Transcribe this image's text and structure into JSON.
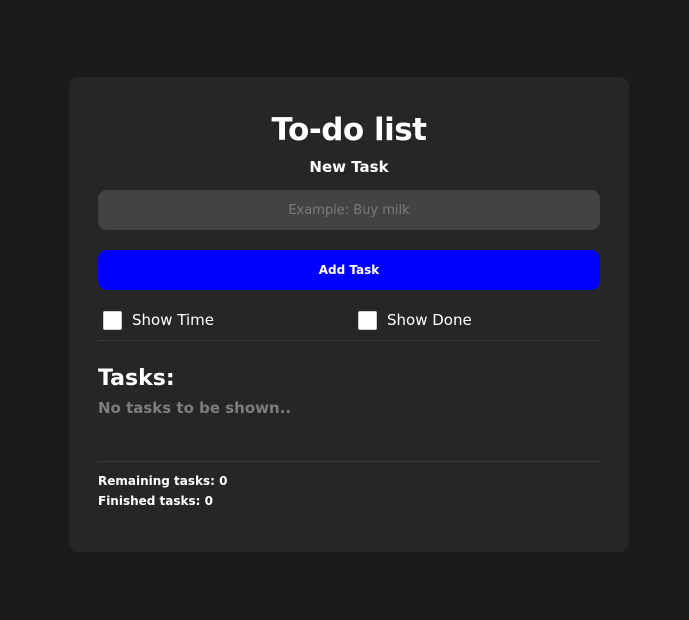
{
  "app": {
    "title": "To-do list",
    "subtitle": "New Task"
  },
  "new_task": {
    "placeholder": "Example: Buy milk",
    "value": "",
    "add_label": "Add Task"
  },
  "options": {
    "show_time": {
      "label": "Show Time",
      "checked": false
    },
    "show_done": {
      "label": "Show Done",
      "checked": false
    }
  },
  "tasks": {
    "heading": "Tasks:",
    "empty_message": "No tasks to be shown..",
    "items": []
  },
  "stats": {
    "remaining_label": "Remaining tasks:",
    "remaining": "0",
    "finished_label": "Finished tasks:",
    "finished": "0"
  },
  "colors": {
    "background": "#1b1b1b",
    "card": "#262626",
    "input": "#434343",
    "accent": "#0000ff",
    "muted_text": "#7d7d7d"
  }
}
